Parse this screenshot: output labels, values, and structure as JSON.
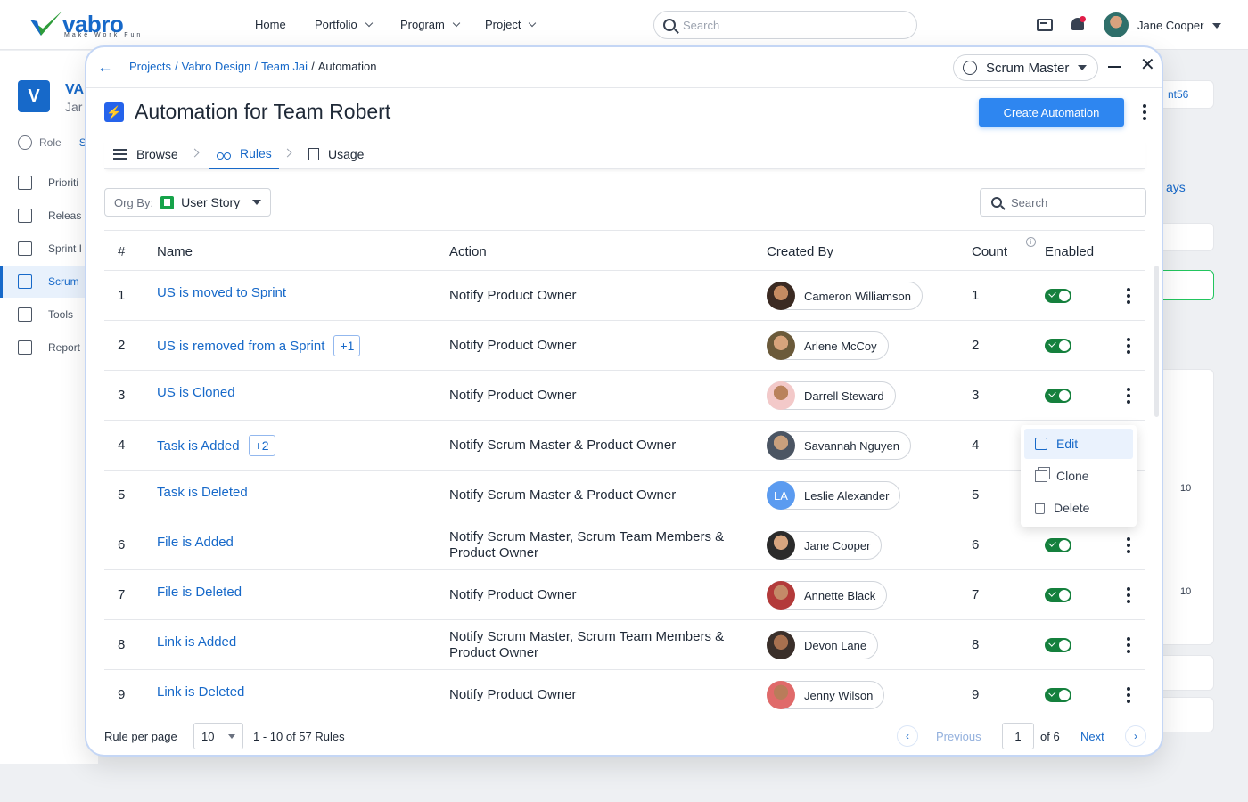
{
  "topnav": {
    "logo_text": "vabro",
    "logo_tagline": "Make Work Fun",
    "menu": [
      {
        "label": "Home"
      },
      {
        "label": "Portfolio"
      },
      {
        "label": "Program"
      },
      {
        "label": "Project"
      }
    ],
    "search_placeholder": "Search",
    "user_name": "Jane Cooper"
  },
  "background": {
    "project_badge": "V",
    "project_name": "VA",
    "project_sub": "Jar",
    "role_label": "Role",
    "role_value": "Sc",
    "menu": [
      {
        "label": "Prioriti"
      },
      {
        "label": "Releas"
      },
      {
        "label": "Sprint I"
      },
      {
        "label": "Scrum"
      },
      {
        "label": "Tools"
      },
      {
        "label": "Report"
      }
    ],
    "right_select": "nt56",
    "right_days": "ays",
    "timer_1": "10",
    "timer_2": "10"
  },
  "modal": {
    "breadcrumb": {
      "links": [
        "Projects",
        "Vabro Design",
        "Team Jai"
      ],
      "current": "Automation"
    },
    "role_select": "Scrum Master",
    "title": "Automation for Team Robert",
    "create_button": "Create Automation",
    "tabs": [
      {
        "label": "Browse",
        "active": false
      },
      {
        "label": "Rules",
        "active": true
      },
      {
        "label": "Usage",
        "active": false
      }
    ],
    "org_by_label": "Org By:",
    "org_by_value": "User Story",
    "search_placeholder": "Search",
    "columns": [
      "#",
      "Name",
      "Action",
      "Created By",
      "Count",
      "Enabled"
    ],
    "rows": [
      {
        "num": "1",
        "name": "US is moved to Sprint",
        "extra": "",
        "action": "Notify Product Owner",
        "created_by": "Cameron Williamson",
        "initials": "",
        "count": "1",
        "enabled": true
      },
      {
        "num": "2",
        "name": "US is removed from a Sprint",
        "extra": "+1",
        "action": "Notify Product Owner",
        "created_by": "Arlene McCoy",
        "initials": "",
        "count": "2",
        "enabled": true
      },
      {
        "num": "3",
        "name": "US is Cloned",
        "extra": "",
        "action": "Notify Product Owner",
        "created_by": "Darrell Steward",
        "initials": "",
        "count": "3",
        "enabled": true
      },
      {
        "num": "4",
        "name": "Task is Added",
        "extra": "+2",
        "action": "Notify Scrum Master & Product Owner",
        "created_by": "Savannah Nguyen",
        "initials": "",
        "count": "4",
        "enabled": null
      },
      {
        "num": "5",
        "name": "Task is Deleted",
        "extra": "",
        "action": "Notify Scrum Master & Product Owner",
        "created_by": "Leslie Alexander",
        "initials": "LA",
        "count": "5",
        "enabled": null
      },
      {
        "num": "6",
        "name": "File is Added",
        "extra": "",
        "action": "Notify Scrum Master, Scrum Team Members & Product Owner",
        "created_by": "Jane Cooper",
        "initials": "",
        "count": "6",
        "enabled": true
      },
      {
        "num": "7",
        "name": "File is Deleted",
        "extra": "",
        "action": "Notify Product Owner",
        "created_by": "Annette Black",
        "initials": "",
        "count": "7",
        "enabled": true
      },
      {
        "num": "8",
        "name": "Link is Added",
        "extra": "",
        "action": "Notify Scrum Master, Scrum Team Members & Product Owner",
        "created_by": "Devon Lane",
        "initials": "",
        "count": "8",
        "enabled": true
      },
      {
        "num": "9",
        "name": "Link is Deleted",
        "extra": "",
        "action": "Notify Product Owner",
        "created_by": "Jenny Wilson",
        "initials": "",
        "count": "9",
        "enabled": true
      }
    ],
    "context_menu": [
      {
        "label": "Edit"
      },
      {
        "label": "Clone"
      },
      {
        "label": "Delete"
      }
    ],
    "pagination": {
      "per_page_label": "Rule per page",
      "per_page_value": "10",
      "range_text": "1 - 10 of 57 Rules",
      "previous": "Previous",
      "current_page": "1",
      "of_pages": "of 6",
      "next": "Next"
    }
  },
  "colors": {
    "accent": "#1769c9",
    "primary_button": "#2e86f0",
    "toggle_on": "#15803d"
  }
}
